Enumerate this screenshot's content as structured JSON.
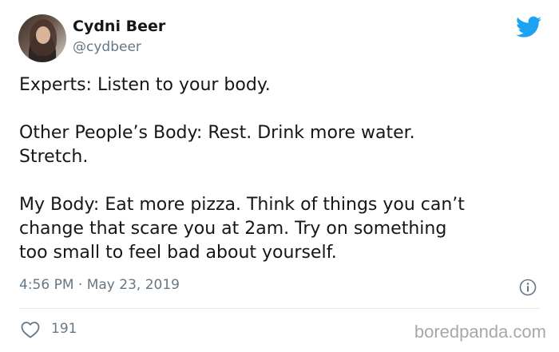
{
  "author": {
    "name": "Cydni Beer",
    "handle": "@cydbeer"
  },
  "tweet": {
    "text": "Experts: Listen to your body.\n\nOther People’s Body: Rest. Drink more water.\nStretch.\n\nMy Body: Eat more pizza. Think of things you can’t\nchange that scare you at 2am. Try on something\ntoo small to feel bad about yourself.",
    "timestamp": "4:56 PM · May 23, 2019",
    "likes": "191"
  },
  "watermark": "boredpanda.com",
  "icons": {
    "brand": "twitter-bird-icon",
    "info": "info-icon",
    "like": "heart-icon"
  },
  "colors": {
    "twitter_blue": "#1da1f2",
    "secondary_text": "#657786",
    "primary_text": "#14171a",
    "divider": "#e1e8ed"
  }
}
